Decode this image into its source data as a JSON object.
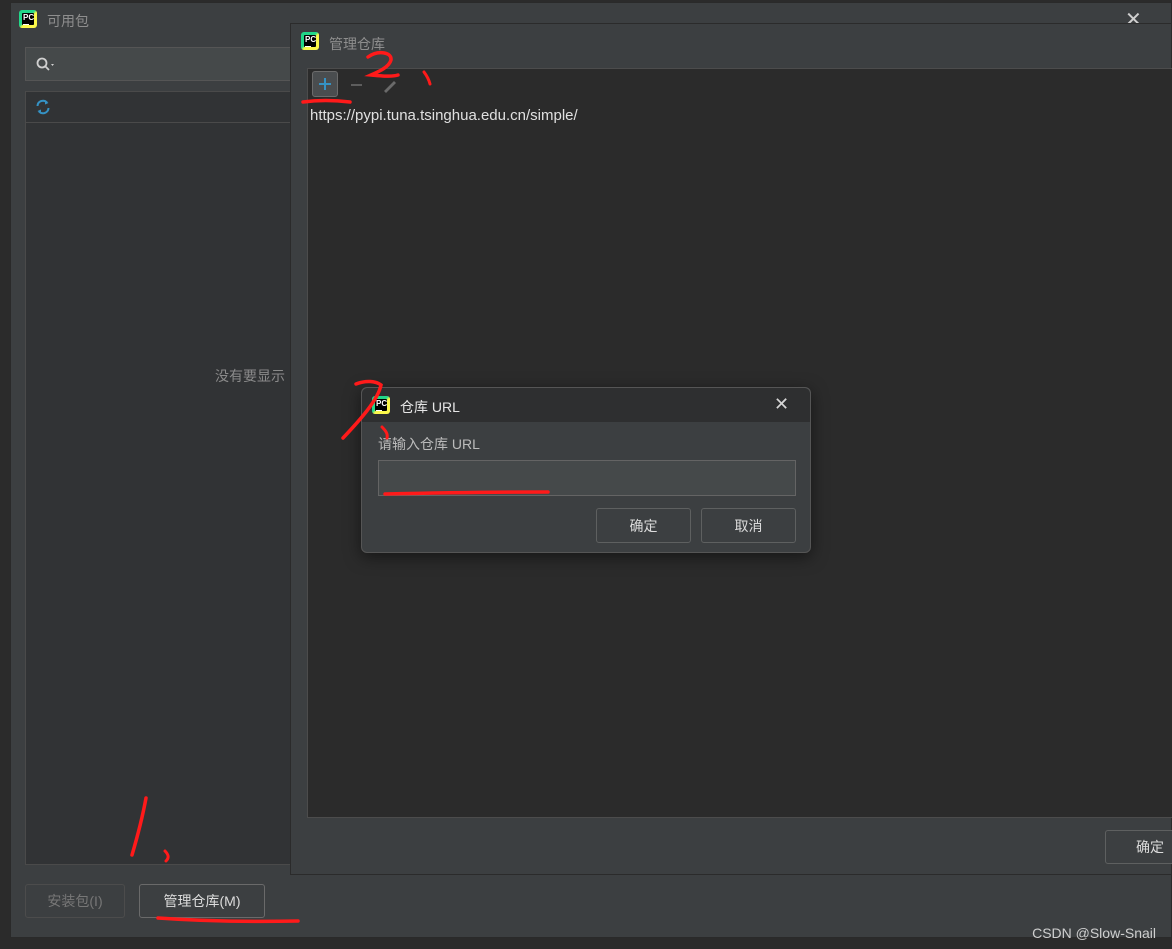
{
  "available_window": {
    "title": "可用包",
    "empty_text": "没有要显示",
    "install_button": "安装包(I)",
    "manage_button": "管理仓库(M)"
  },
  "repos_window": {
    "title": "管理仓库",
    "repositories": [
      "https://pypi.tuna.tsinghua.edu.cn/simple/"
    ],
    "ok_button": "确定"
  },
  "url_dialog": {
    "title": "仓库 URL",
    "label": "请输入仓库 URL",
    "input_value": "",
    "ok_button": "确定",
    "cancel_button": "取消"
  },
  "annotations": {
    "step1": "1、",
    "step2": "2、",
    "step3": "3、"
  },
  "watermark": "CSDN @Slow-Snail",
  "colors": {
    "annotation": "#ff1a1a",
    "accent": "#3592c4"
  }
}
